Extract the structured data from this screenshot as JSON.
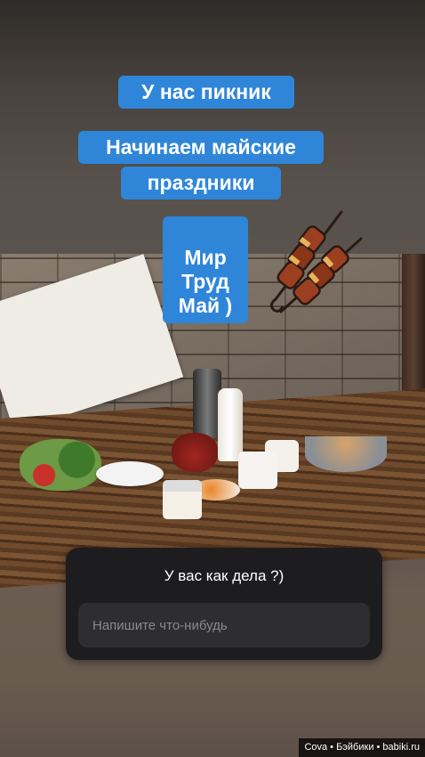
{
  "story": {
    "caption_1": "У нас пикник",
    "caption_2_line1": "Начинаем майские",
    "caption_2_line2": "праздники",
    "caption_3": "Мир\nТруд\nМай )"
  },
  "question_sticker": {
    "title": "У вас как дела ?)",
    "input_placeholder": "Напишите что-нибудь",
    "input_value": ""
  },
  "watermark": "Cova • Бэйбики • babiki.ru",
  "icons": {
    "sticker": "kebab-skewer-icon"
  },
  "colors": {
    "caption_bg": "#2f86d9",
    "caption_text": "#ffffff",
    "question_bg": "#1d1d1f",
    "question_input_bg": "#2e2e31"
  }
}
